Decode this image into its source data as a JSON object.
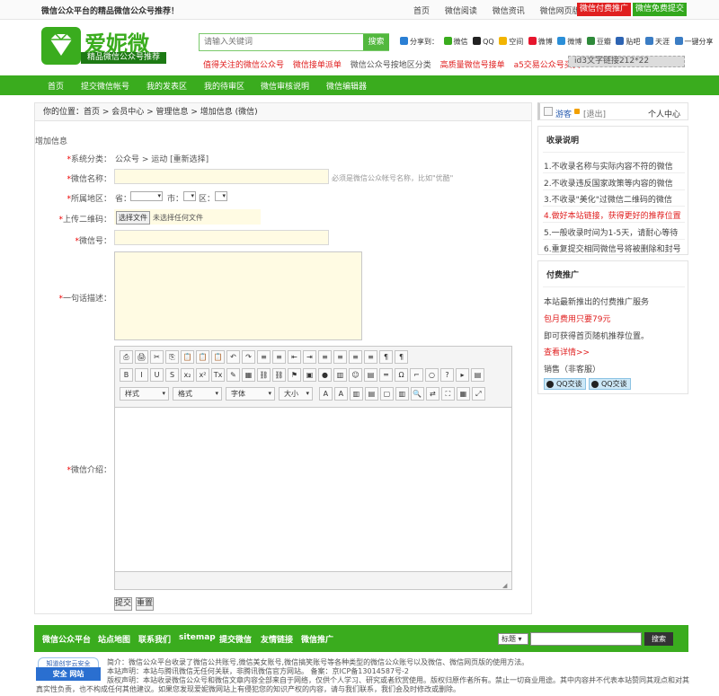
{
  "topbar": {
    "slogan": "微信公众平台的精品微信公众号推荐！",
    "links": [
      "首页",
      "微信阅读",
      "微信资讯",
      "微信网页版"
    ],
    "btn_paid": "微信付费推广",
    "btn_free": "微信免费提交"
  },
  "logo": {
    "title": "爱妮微",
    "subtitle": "精品微信公众号推荐"
  },
  "search": {
    "placeholder": "请输入关键词",
    "button": "搜索"
  },
  "share": {
    "label": "分享到：",
    "items": [
      "微信",
      "QQ",
      "空间",
      "微博",
      "微博",
      "豆瓣",
      "贴吧",
      "天涯",
      "一键分享"
    ]
  },
  "hotlinks": [
    "值得关注的微信公众号",
    "微信接单派单",
    "微信公众号按地区分类",
    "高质量微信号接单",
    "a5交易公众号买卖"
  ],
  "ad_text": "id3文字链接212*22",
  "nav": [
    "首页",
    "提交微信帐号",
    "我的发表区",
    "我的待审区",
    "微信审核说明",
    "微信编辑器"
  ],
  "breadcrumb": "你的位置：首页 > 会员中心 > 管理信息 > 增加信息 (微信)",
  "form": {
    "section_title": "增加信息",
    "category_label": "*系统分类：",
    "category_value": "公众号 > 运动 [重新选择]",
    "name_label": "*微信名称：",
    "name_hint": "必须是微信公众帐号名称，比如\"优酷\"",
    "region_label": "*所属地区：",
    "province": "省：",
    "city": "市：",
    "district": "区：",
    "upload_label": "*上传二维码：",
    "upload_button": "选择文件",
    "upload_status": "未选择任何文件",
    "wxid_label": "*微信号：",
    "desc_label": "*一句话描述：",
    "intro_label": "*微信介绍：",
    "submit": "提交",
    "reset": "重置"
  },
  "editor": {
    "row1": [
      "⎙",
      "🖨",
      "✂",
      "⎘",
      "📋",
      "📋",
      "📋",
      "↶",
      "↷",
      "≡",
      "≡",
      "⇤",
      "⇥",
      "≡",
      "≡",
      "≡",
      "≡",
      "¶",
      "¶"
    ],
    "row2": [
      "B",
      "I",
      "U",
      "S",
      "x₂",
      "x²",
      "Tx",
      "✎",
      "▦",
      "⛓",
      "⛓",
      "⚑",
      "▣",
      "●",
      "▥",
      "☺",
      "▤",
      "═",
      "Ω",
      "⌐",
      "○",
      "?",
      "▸",
      "▤"
    ],
    "row3_selects": [
      "样式",
      "格式",
      "字体",
      "大小"
    ],
    "row3": [
      "A",
      "A",
      "▥",
      "▤",
      "▢",
      "▥",
      "🔍",
      "⇄",
      "⛶",
      "▦",
      "⤢"
    ]
  },
  "sidebar": {
    "guest": "游客",
    "logout": "[退出]",
    "user_center": "个人中心",
    "rules_title": "收录说明",
    "rules": [
      "1.不收录名称与实际内容不符的微信",
      "2.不收录违反国家政策等内容的微信",
      "3.不收录\"美化\"过微信二维码的微信",
      "4.做好本站链接，获得更好的推荐位置",
      "5.一般收录时间为1-5天，请耐心等待",
      "6.重复提交相同微信号将被删除和封号"
    ],
    "promo_title": "付费推广",
    "promo_line1": "本站最新推出的付费推广服务",
    "promo_price": "包月费用只要79元",
    "promo_line2": "即可获得首页随机推荐位置。",
    "promo_link": "查看详情>>",
    "sales": "销售（非客服）",
    "qq1": "QQ交谈",
    "qq2": "QQ交谈"
  },
  "footer": {
    "links": [
      "微信公众平台",
      "站点地图",
      "联系我们",
      "sitemap",
      "提交微信",
      "友情链接",
      "微信推广"
    ],
    "select": "标题",
    "search_button": "搜索",
    "badge_top": "知道创宇云安全",
    "badge_bottom": "安全 网站",
    "note1": "简介：微信公众平台收录了微信公共账号,微信美女账号,微信搞笑账号等各种类型的微信公众账号以及微信、微信网页版的使用方法。",
    "note2": "本站声明：本站与腾讯微信无任何关联，非腾讯微信官方网站。  备案：京ICP备13014587号-2",
    "note3": "版权声明：本站收录微信公众号和微信文章内容全部来自于网络，仅供个人学习、研究或者欣赏使用。版权归原作者所有。禁止一切商业用途。其中内容并不代表本站赞同其观点和对其真实性负责，也不构成任何其他建议。如果您发现爱妮微网站上有侵犯您的知识产权的内容，请与我们联系，我们会及时修改或删除。"
  },
  "colors": {
    "brand_green": "#3aac1e",
    "alert_red": "#e02020"
  }
}
